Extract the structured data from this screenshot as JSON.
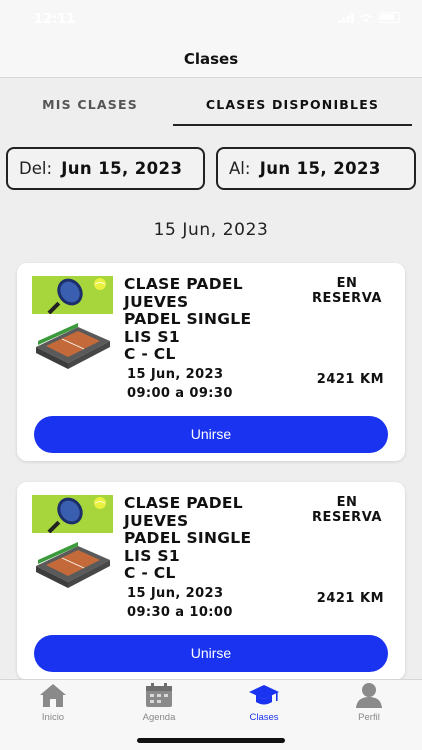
{
  "status_bar": {
    "time": "12:11"
  },
  "header": {
    "title": "Clases"
  },
  "tabs": [
    {
      "label": "MIS CLASES",
      "active": false
    },
    {
      "label": "CLASES DISPONIBLES",
      "active": true
    }
  ],
  "filters": {
    "from_prefix": "Del:",
    "from_value": "Jun 15, 2023",
    "to_prefix": "Al:",
    "to_value": "Jun 15, 2023"
  },
  "date_heading": "15 Jun, 2023",
  "classes": [
    {
      "name_lines": [
        "CLASE PADEL",
        "JUEVES",
        "PADEL SINGLE",
        "LIS S1",
        "C - CL"
      ],
      "date": "15 Jun, 2023",
      "time": "09:00 a 09:30",
      "status_lines": [
        "EN",
        "RESERVA"
      ],
      "distance": "2421 KM",
      "button_label": "Unirse"
    },
    {
      "name_lines": [
        "CLASE PADEL",
        "JUEVES",
        "PADEL SINGLE",
        "LIS S1",
        "C - CL"
      ],
      "date": "15 Jun, 2023",
      "time": "09:30 a 10:00",
      "status_lines": [
        "EN",
        "RESERVA"
      ],
      "distance": "2421 KM",
      "button_label": "Unirse"
    }
  ],
  "bottom_nav": [
    {
      "label": "Inicio",
      "icon": "home-icon",
      "active": false
    },
    {
      "label": "Agenda",
      "icon": "calendar-icon",
      "active": false
    },
    {
      "label": "Clases",
      "icon": "graduation-cap-icon",
      "active": true
    },
    {
      "label": "Perfil",
      "icon": "user-icon",
      "active": false
    }
  ],
  "colors": {
    "accent": "#1a33f0",
    "background": "#eeeeee",
    "card": "#ffffff",
    "inactive_nav": "#888888"
  }
}
